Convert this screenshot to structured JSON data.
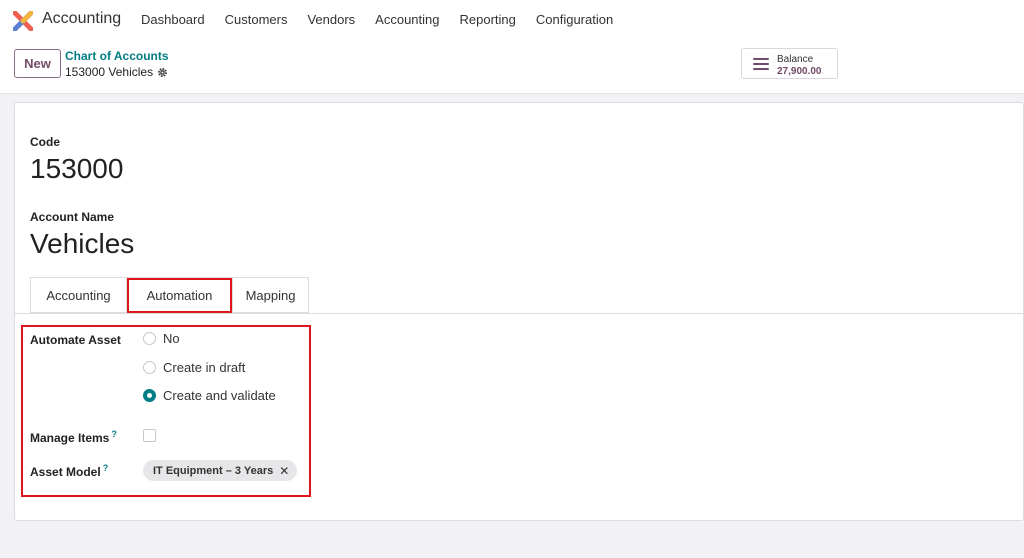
{
  "navbar": {
    "app_name": "Accounting",
    "menu": [
      "Dashboard",
      "Customers",
      "Vendors",
      "Accounting",
      "Reporting",
      "Configuration"
    ]
  },
  "control": {
    "new_label": "New",
    "breadcrumb_parent": "Chart of Accounts",
    "breadcrumb_current": "153000 Vehicles",
    "balance_label": "Balance",
    "balance_value": "27,900.00"
  },
  "form": {
    "code_label": "Code",
    "code_value": "153000",
    "name_label": "Account Name",
    "name_value": "Vehicles",
    "tabs": [
      "Accounting",
      "Automation",
      "Mapping"
    ],
    "active_tab": "Automation",
    "automate_asset_label": "Automate Asset",
    "automate_options": [
      "No",
      "Create in draft",
      "Create and validate"
    ],
    "automate_selected": "Create and validate",
    "manage_items_label": "Manage Items",
    "manage_items_checked": false,
    "asset_model_label": "Asset Model",
    "asset_model_tag": "IT Equipment – 3 Years",
    "help_mark": "?"
  },
  "colors": {
    "brand": "#714B67",
    "accent": "#017e84",
    "highlight": "#e0141a"
  }
}
